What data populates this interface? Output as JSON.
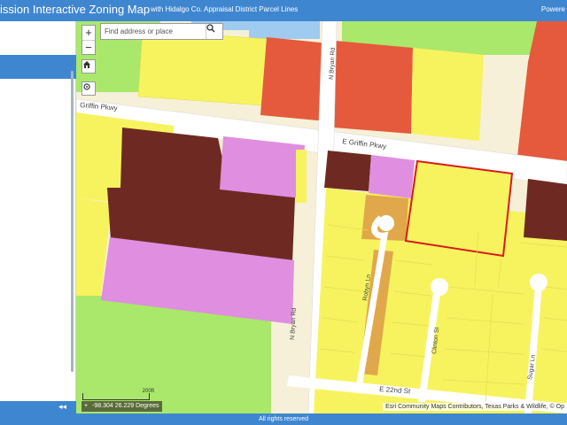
{
  "header": {
    "title": "ission Interactive Zoning Map",
    "subtitle": "with Hidalgo Co. Appraisal District Parcel Lines",
    "powered_by": "Powere"
  },
  "sidebar": {
    "collapse_label": "◂◂"
  },
  "search": {
    "placeholder": "Find address or place"
  },
  "map": {
    "zoom_in": "+",
    "zoom_out": "−",
    "scale_label": "200ft",
    "coordinates": "-98.304 26.229 Degrees",
    "attribution": "Esri Community Maps Contributors, Texas Parks & Wildlife, © Op",
    "street_labels": {
      "griffin_west": "Griffin Pkwy",
      "griffin_east": "E Griffin Pkwy",
      "bryan_north": "N Bryan Rd",
      "bryan_south": "N Bryan Rd",
      "robyn": "Robyn Ln",
      "clinton": "Clinton St",
      "sugar": "Sugar Ln",
      "e22nd": "E 22nd St"
    },
    "zone_colors": {
      "residential": "#f7f35e",
      "commercial": "#e55a3c",
      "industrial": "#6e2a22",
      "institutional": "#e08ee0",
      "agricultural": "#a9e86a",
      "townhouse": "#e0a84a",
      "water": "#9ecbef",
      "selection": "#d81b1b"
    }
  },
  "footer": {
    "rights": "All rights reserved"
  }
}
